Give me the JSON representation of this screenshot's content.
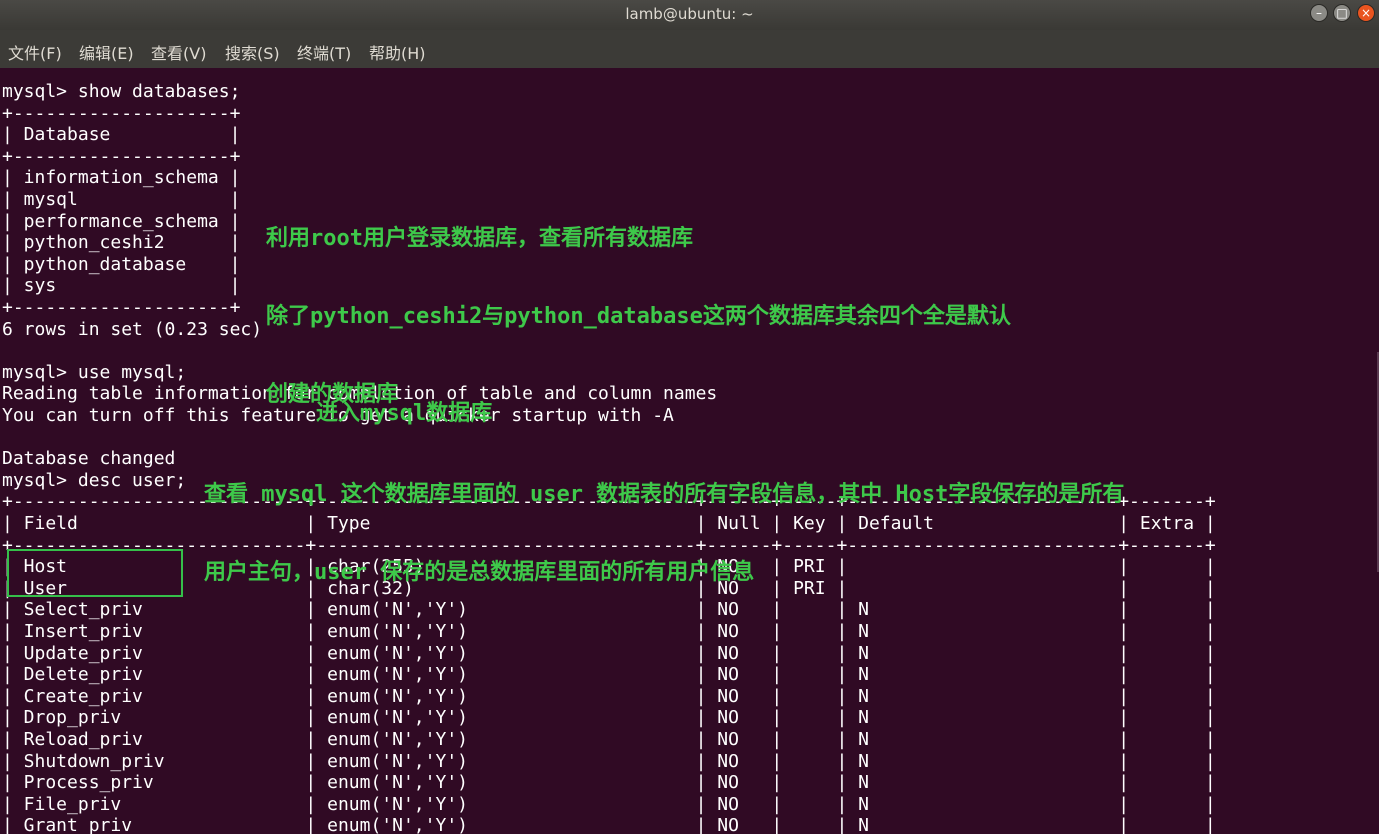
{
  "window": {
    "title": "lamb@ubuntu: ~",
    "buttons": {
      "minimize": "minimize-icon",
      "maximize": "maximize-icon",
      "close": "close-icon"
    }
  },
  "menu": {
    "items": [
      "文件(F)",
      "编辑(E)",
      "查看(V)",
      "搜索(S)",
      "终端(T)",
      "帮助(H)"
    ]
  },
  "terminal": {
    "lines": [
      "mysql> show databases;",
      "+--------------------+",
      "| Database           |",
      "+--------------------+",
      "| information_schema |",
      "| mysql              |",
      "| performance_schema |",
      "| python_ceshi2      |",
      "| python_database    |",
      "| sys                |",
      "+--------------------+",
      "6 rows in set (0.23 sec)",
      "",
      "mysql> use mysql;",
      "Reading table information for completion of table and column names",
      "You can turn off this feature to get a quicker startup with -A",
      "",
      "Database changed",
      "mysql> desc user;",
      "+---------------------------+-----------------------------------+------+-----+-------------------------+-------+",
      "| Field                     | Type                              | Null | Key | Default                 | Extra |",
      "+---------------------------+-----------------------------------+------+-----+-------------------------+-------+",
      "| Host                      | char(255)                         | NO   | PRI |                         |       |",
      "| User                      | char(32)                          | NO   | PRI |                         |       |",
      "| Select_priv               | enum('N','Y')                     | NO   |     | N                       |       |",
      "| Insert_priv               | enum('N','Y')                     | NO   |     | N                       |       |",
      "| Update_priv               | enum('N','Y')                     | NO   |     | N                       |       |",
      "| Delete_priv               | enum('N','Y')                     | NO   |     | N                       |       |",
      "| Create_priv               | enum('N','Y')                     | NO   |     | N                       |       |",
      "| Drop_priv                 | enum('N','Y')                     | NO   |     | N                       |       |",
      "| Reload_priv               | enum('N','Y')                     | NO   |     | N                       |       |",
      "| Shutdown_priv             | enum('N','Y')                     | NO   |     | N                       |       |",
      "| Process_priv              | enum('N','Y')                     | NO   |     | N                       |       |",
      "| File_priv                 | enum('N','Y')                     | NO   |     | N                       |       |",
      "| Grant_priv                | enum('N','Y')                     | NO   |     | N                       |       |"
    ]
  },
  "annotations": {
    "a1": [
      "利用root用户登录数据库，查看所有数据库",
      "除了python_ceshi2与python_database这两个数据库其余四个全是默认",
      "创建的数据库"
    ],
    "a2": [
      "进入mysql数据库"
    ],
    "a3": [
      "查看 mysql 这个数据库里面的 user 数据表的所有字段信息，其中 Host字段保存的是所有",
      "用户主句，user 保存的是总数据库里面的所有用户信息"
    ]
  },
  "colors": {
    "background": "#300a24",
    "text": "#ffffff",
    "annotation": "#3ec94a",
    "highlight": "#35c04a"
  }
}
